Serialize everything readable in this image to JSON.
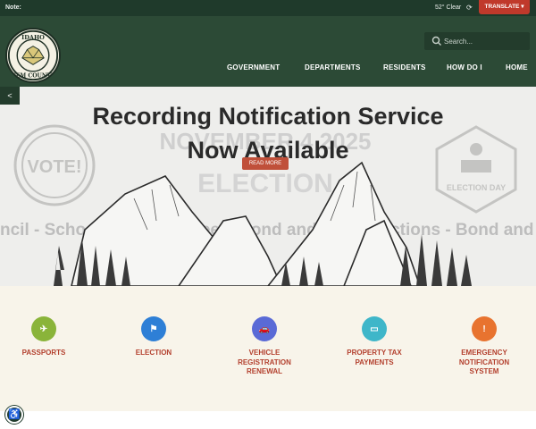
{
  "topbar": {
    "note_label": "Note:",
    "weather": "52° Clear",
    "refresh_icon": "refresh-icon",
    "translate_label": "TRANSLATE ▾"
  },
  "header": {
    "logo_icon": "county-seal",
    "logo_text_top": "IDAHO",
    "logo_text_bottom": "GEM COUNTY",
    "search_placeholder": "Search...",
    "nav": [
      "GOVERNMENT",
      "DEPARTMENTS",
      "RESIDENTS",
      "HOW DO I",
      "HOME"
    ]
  },
  "hero": {
    "title_line1": "Recording Notification Service",
    "title_line2": "Now Available",
    "read_more": "READ MORE",
    "bg_date": "NOVEMBER 4 2025",
    "bg_election": "ELECTION",
    "bg_ticker": "ncil  -  School Board Trustee...   Bond and Levy Elections   -   Bond and Levy O",
    "bg_vote": "VOTE!",
    "bg_election_day": "ELECTION DAY"
  },
  "quick_links": [
    {
      "label": "PASSPORTS",
      "icon": "airplane-icon",
      "color": "#8ab43a"
    },
    {
      "label": "ELECTION",
      "icon": "flag-icon",
      "color": "#2e7fd6"
    },
    {
      "label": "VEHICLE\nREGISTRATION\nRENEWAL",
      "icon": "car-icon",
      "color": "#5a6ad6"
    },
    {
      "label": "PROPERTY TAX\nPAYMENTS",
      "icon": "credit-card-icon",
      "color": "#3fb6c9"
    },
    {
      "label": "EMERGENCY\nNOTIFICATION\nSYSTEM",
      "icon": "alert-icon",
      "color": "#e8732f"
    }
  ],
  "accessibility_icon": "accessibility-icon",
  "share_icon": "share-icon"
}
